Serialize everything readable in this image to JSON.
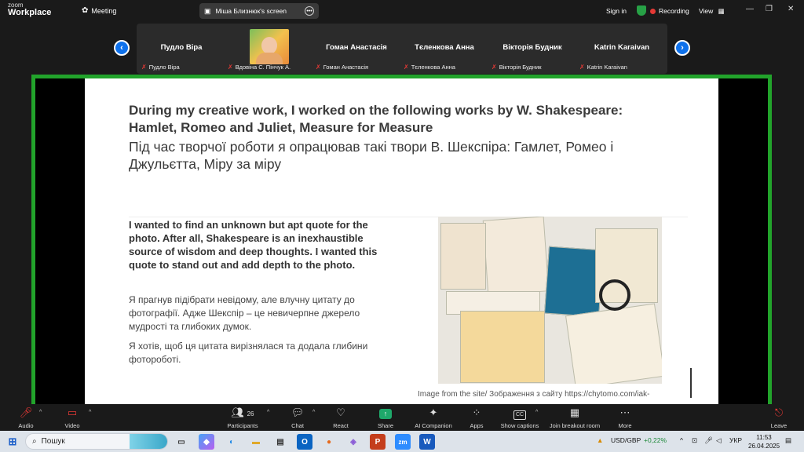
{
  "app": {
    "logo_line1": "zoom",
    "logo_line2": "Workplace",
    "meeting_label": "Meeting",
    "screen_share_label": "Міша Близнюк's screen",
    "sign_in": "Sign in",
    "recording": "Recording",
    "view": "View"
  },
  "participants": [
    {
      "big_name": "Пудло Віра",
      "small_name": "Пудло Віра"
    },
    {
      "big_name": "",
      "small_name": "Вдовіна С. Пінчук А."
    },
    {
      "big_name": "Гоман Анастасія",
      "small_name": "Гоман Анастасія"
    },
    {
      "big_name": "Тєленкова Анна",
      "small_name": "Тєленкова Анна"
    },
    {
      "big_name": "Вікторія Будник",
      "small_name": "Вікторія Будник"
    },
    {
      "big_name": "Katrin Karaivan",
      "small_name": "Katrin Karaivan"
    }
  ],
  "slide": {
    "title_en": "During my creative work, I worked on the following works by W. Shakespeare: Hamlet, Romeo and Juliet, Measure for Measure",
    "title_ua": "Під час творчої роботи я опрацював такі твори В. Шекспіра: Гамлет, Ромео і Джульєтта, Міру за міру",
    "para_en": "I wanted to find an unknown but apt quote for the photo. After all, Shakespeare is an inexhaustible source of wisdom and deep thoughts. I wanted this quote to stand out and add depth to the photo.",
    "para_ua1": "Я прагнув підібрати невідому,  але влучну цитату до фотографії. Адже Шекспір – це невичерпне джерело мудрості та глибоких думок.",
    "para_ua2": "Я хотів, щоб ця  цитата вирізнялася та додала глибини фотороботі.",
    "caption": "Image from the site/ Зображення з сайту https://chytomo.com/iak-"
  },
  "toolbar": {
    "audio": "Audio",
    "video": "Video",
    "participants": "Participants",
    "participants_count": "26",
    "chat": "Chat",
    "react": "React",
    "share": "Share",
    "ai_companion": "AI Companion",
    "apps": "Apps",
    "show_captions": "Show captions",
    "breakout": "Join breakout room",
    "more": "More",
    "leave": "Leave"
  },
  "taskbar": {
    "search_placeholder": "Пошук",
    "currency": "USD/GBP",
    "currency_change": "+0,22%",
    "lang": "УКР",
    "time": "11:53",
    "date": "26.04.2025"
  },
  "colors": {
    "share_border": "#22a32b",
    "nav_blue": "#0e71eb",
    "share_button": "#1ea86a",
    "recording_red": "#e53935"
  }
}
